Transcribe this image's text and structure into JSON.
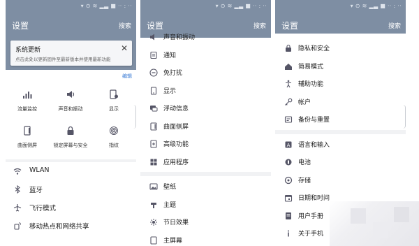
{
  "accent": "#7e8ea3",
  "link_color": "#3a7bd5",
  "panel1": {
    "title": "设置",
    "search": "搜索",
    "update_card": {
      "title": "系统更新",
      "description": "点击此处以更新固件至最新版本并使用最新功能",
      "close": "✕"
    },
    "edit": "编辑",
    "tiles": [
      {
        "label": "流量监控",
        "icon": "bar-chart-icon"
      },
      {
        "label": "声音和振动",
        "icon": "speaker-icon"
      },
      {
        "label": "显示",
        "icon": "phone-brightness-icon"
      },
      {
        "label": "曲面侧屏",
        "icon": "edge-screen-icon"
      },
      {
        "label": "锁定屏幕与安全",
        "icon": "lock-icon"
      },
      {
        "label": "指纹",
        "icon": "fingerprint-icon"
      }
    ],
    "items": [
      {
        "label": "WLAN",
        "icon": "wifi-icon"
      },
      {
        "label": "蓝牙",
        "icon": "bluetooth-icon"
      },
      {
        "label": "飞行模式",
        "icon": "airplane-icon"
      },
      {
        "label": "移动热点和网络共享",
        "icon": "hotspot-icon"
      }
    ]
  },
  "panel2": {
    "title": "设置",
    "search": "搜索",
    "items_a": [
      {
        "label": "声音和振动",
        "icon": "speaker-icon"
      },
      {
        "label": "通知",
        "icon": "notification-icon"
      },
      {
        "label": "免打扰",
        "icon": "do-not-disturb-icon"
      },
      {
        "label": "显示",
        "icon": "display-icon"
      },
      {
        "label": "浮动信息",
        "icon": "floating-message-icon"
      },
      {
        "label": "曲面侧屏",
        "icon": "edge-screen-icon"
      },
      {
        "label": "高级功能",
        "icon": "advanced-features-icon"
      },
      {
        "label": "应用程序",
        "icon": "apps-icon"
      }
    ],
    "items_b": [
      {
        "label": "壁纸",
        "icon": "wallpaper-icon"
      },
      {
        "label": "主题",
        "icon": "themes-icon"
      },
      {
        "label": "节日效果",
        "icon": "festival-icon"
      },
      {
        "label": "主屏幕",
        "icon": "home-screen-icon"
      }
    ]
  },
  "panel3": {
    "title": "设置",
    "search": "搜索",
    "items_a": [
      {
        "label": "隐私和安全",
        "icon": "privacy-icon"
      },
      {
        "label": "简易模式",
        "icon": "easy-mode-icon"
      },
      {
        "label": "辅助功能",
        "icon": "accessibility-icon"
      },
      {
        "label": "帐户",
        "icon": "key-icon"
      },
      {
        "label": "备份与重置",
        "icon": "backup-icon"
      }
    ],
    "items_b": [
      {
        "label": "语言和输入",
        "icon": "language-icon"
      },
      {
        "label": "电池",
        "icon": "battery-icon"
      },
      {
        "label": "存储",
        "icon": "storage-icon"
      },
      {
        "label": "日期和时间",
        "icon": "calendar-icon"
      },
      {
        "label": "用户手册",
        "icon": "manual-icon"
      },
      {
        "label": "关于手机",
        "icon": "info-icon"
      }
    ]
  }
}
